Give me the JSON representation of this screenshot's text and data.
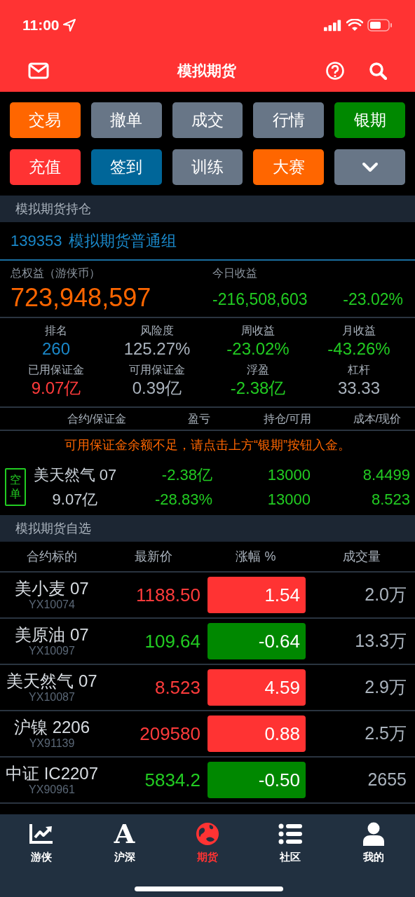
{
  "status_bar": {
    "time": "11:00"
  },
  "header": {
    "title": "模拟期货"
  },
  "quick_buttons": [
    {
      "label": "交易",
      "color": "#ff6600"
    },
    {
      "label": "撤单",
      "color": "#687687"
    },
    {
      "label": "成交",
      "color": "#687687"
    },
    {
      "label": "行情",
      "color": "#687687"
    },
    {
      "label": "银期",
      "color": "#008800"
    },
    {
      "label": "充值",
      "color": "#ff3333"
    },
    {
      "label": "签到",
      "color": "#006699"
    },
    {
      "label": "训练",
      "color": "#687687"
    },
    {
      "label": "大赛",
      "color": "#ff6600"
    },
    {
      "kind": "more",
      "color": "#687687"
    }
  ],
  "holdings": {
    "section_title": "模拟期货持仓",
    "account_id": "139353",
    "group": "模拟期货普通组",
    "equity_label": "总权益（游侠币）",
    "equity": "723,948,597",
    "today_label": "今日收益",
    "today_value": "-216,508,603",
    "today_pct": "-23.02%",
    "stats": [
      {
        "label": "排名",
        "value": "260",
        "color": "#1a88c9"
      },
      {
        "label": "风险度",
        "value": "125.27%",
        "color": "#aab3bd"
      },
      {
        "label": "周收益",
        "value": "-23.02%",
        "color": "#22cc22"
      },
      {
        "label": "月收益",
        "value": "-43.26%",
        "color": "#22cc22"
      },
      {
        "label": "已用保证金",
        "value": "9.07亿",
        "color": "#ff3b3b"
      },
      {
        "label": "可用保证金",
        "value": "0.39亿",
        "color": "#aab3bd"
      },
      {
        "label": "浮盈",
        "value": "-2.38亿",
        "color": "#22cc22"
      },
      {
        "label": "杠杆",
        "value": "33.33",
        "color": "#aab3bd"
      }
    ],
    "columns": [
      "合约/保证金",
      "盈亏",
      "持仓/可用",
      "成本/现价"
    ],
    "warning": "可用保证金余额不足，请点击上方“银期”按钮入金。",
    "positions": [
      {
        "badge": "空单",
        "name": "美天然气 07",
        "margin": "9.07亿",
        "pl": "-2.38亿",
        "pl_pct": "-28.83%",
        "holding": "13000",
        "available": "13000",
        "cost": "8.4499",
        "price": "8.523"
      }
    ]
  },
  "watchlist": {
    "section_title": "模拟期货自选",
    "columns": [
      "合约标的",
      "最新价",
      "涨幅 %",
      "成交量"
    ],
    "rows": [
      {
        "name": "美小麦 07",
        "code": "YX10074",
        "price": "1188.50",
        "change": "1.54",
        "volume": "2.0万",
        "rising": true
      },
      {
        "name": "美原油 07",
        "code": "YX10097",
        "price": "109.64",
        "change": "-0.64",
        "volume": "13.3万",
        "rising": false
      },
      {
        "name": "美天然气 07",
        "code": "YX10087",
        "price": "8.523",
        "change": "4.59",
        "volume": "2.9万",
        "rising": true
      },
      {
        "name": "沪镍 2206",
        "code": "YX91139",
        "price": "209580",
        "change": "0.88",
        "volume": "2.5万",
        "rising": true
      },
      {
        "name": "中证 IC2207",
        "code": "YX90961",
        "price": "5834.2",
        "change": "-0.50",
        "volume": "2655",
        "rising": false
      }
    ]
  },
  "tab_bar": [
    {
      "label": "游侠",
      "kind": "chart",
      "selected": false
    },
    {
      "label": "沪深",
      "kind": "letter",
      "glyph": "A",
      "selected": false
    },
    {
      "label": "期货",
      "kind": "globe",
      "selected": true
    },
    {
      "label": "社区",
      "kind": "list",
      "selected": false
    },
    {
      "label": "我的",
      "kind": "person",
      "selected": false
    }
  ]
}
